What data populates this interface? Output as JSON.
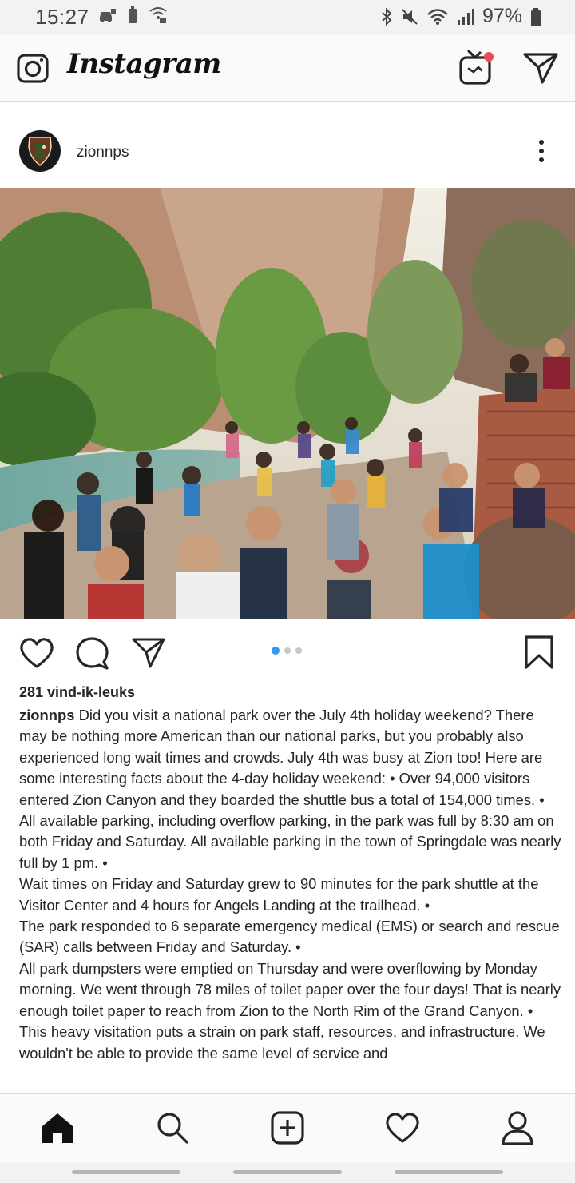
{
  "status_bar": {
    "time": "15:27",
    "battery": "97%",
    "left_icons": [
      "car-notification-icon",
      "battery-saver-icon",
      "wifi-call-icon"
    ],
    "right_icons": [
      "bluetooth-icon",
      "mute-icon",
      "wifi-icon",
      "signal-icon",
      "battery-icon"
    ]
  },
  "app_bar": {
    "title": "Instagram",
    "icons": [
      "camera-icon",
      "igtv-icon",
      "direct-message-icon"
    ],
    "notification_color": "#ed4956"
  },
  "post": {
    "username": "zionnps",
    "avatar_icon": "nps-arrowhead-icon",
    "more_icon": "more-vertical-icon",
    "image_description_icon": "photo-crowd-zion-narrows",
    "carousel": {
      "count": 3,
      "active_index": 0,
      "active_color": "#3897f0"
    },
    "likes": "281 vind-ik-leuks",
    "caption_username": "zionnps",
    "caption_paragraphs": [
      "Did you visit a national park over the July 4th holiday weekend? There may be nothing more American than our national parks, but you probably also experienced long wait times and crowds. July 4th was busy at Zion too! Here are some interesting facts about the 4-day holiday weekend: • Over 94,000 visitors entered Zion Canyon and they boarded the shuttle bus a total of 154,000 times. •",
      "All available parking, including overflow parking, in the park was full by 8:30 am on both Friday and Saturday. All available parking in the town of Springdale was nearly full by 1 pm. •",
      "Wait times on Friday and Saturday grew to 90 minutes for the park shuttle at the Visitor Center and 4 hours for Angels Landing at the trailhead. •",
      "The park responded to 6 separate emergency medical (EMS) or search and rescue (SAR) calls between Friday and Saturday. •",
      "All park dumpsters were emptied on Thursday and were overflowing by Monday morning. We went through 78 miles of toilet paper over the four days! That is nearly enough toilet paper to reach from Zion to the North Rim of the Grand Canyon. •",
      "This heavy visitation puts a strain on park staff, resources, and infrastructure. We wouldn't be able to provide the same level of service and"
    ]
  },
  "bottom_nav": [
    "home-icon",
    "search-icon",
    "new-post-icon",
    "activity-heart-icon",
    "profile-icon"
  ]
}
